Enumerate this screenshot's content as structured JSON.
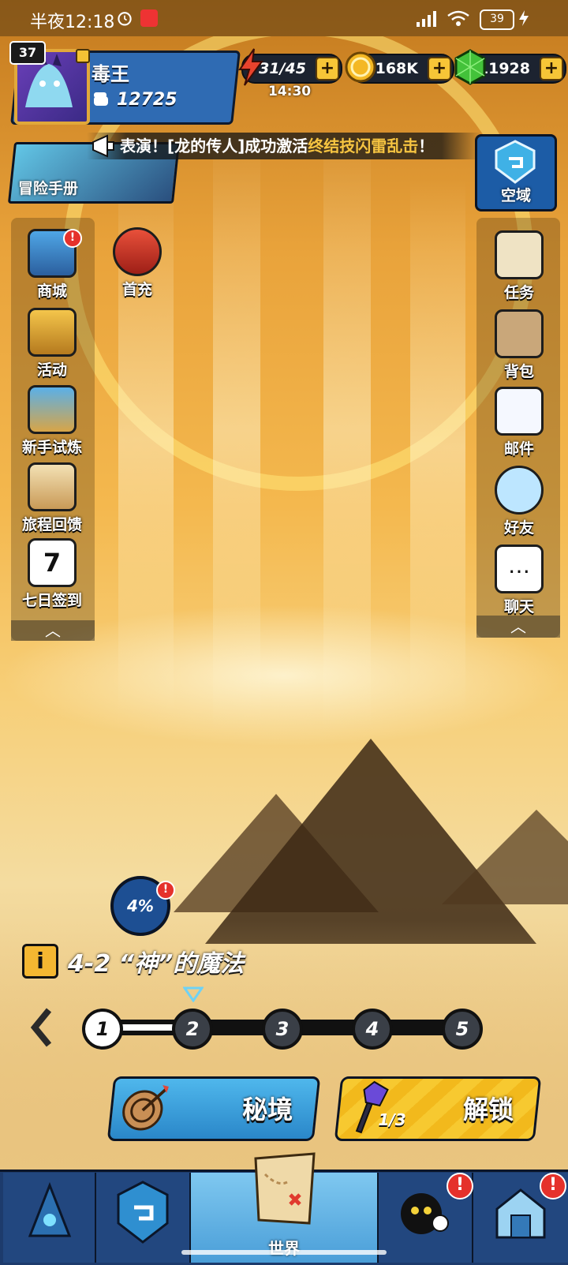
{
  "status_bar": {
    "time": "半夜12:18",
    "battery": "39"
  },
  "player": {
    "level": "37",
    "name": "毒王",
    "power": "12725"
  },
  "resources": {
    "energy": "31/45",
    "energy_timer": "14:30",
    "gold": "168K",
    "gems": "11928"
  },
  "announcement": {
    "prefix": "表演！[龙的传人]成功激活",
    "highlight": "终结技闪雷乱击",
    "suffix": "！"
  },
  "adventure_manual": {
    "label": "冒险手册"
  },
  "sky_domain": {
    "label": "空域"
  },
  "left_menu": [
    {
      "label": "商城"
    },
    {
      "label": "活动"
    },
    {
      "label": "新手试炼"
    },
    {
      "label": "旅程回馈"
    },
    {
      "label": "七日签到"
    }
  ],
  "first_recharge": {
    "label": "首充"
  },
  "right_menu": [
    {
      "label": "任务"
    },
    {
      "label": "背包"
    },
    {
      "label": "邮件"
    },
    {
      "label": "好友"
    },
    {
      "label": "聊天"
    }
  ],
  "progress": {
    "percent": "4%"
  },
  "stage": {
    "info_icon": "i",
    "title": "4-2 “神”的魔法",
    "nodes": [
      "1",
      "2",
      "3",
      "4",
      "5"
    ],
    "current": "2"
  },
  "actions": {
    "secret_label": "秘境",
    "unlock_label": "解锁",
    "unlock_count": "1/3"
  },
  "bottom_nav": {
    "world_label": "世界"
  },
  "colors": {
    "accent_gold": "#f6c441",
    "nav_blue": "#22477f",
    "alert_red": "#e5312b"
  }
}
